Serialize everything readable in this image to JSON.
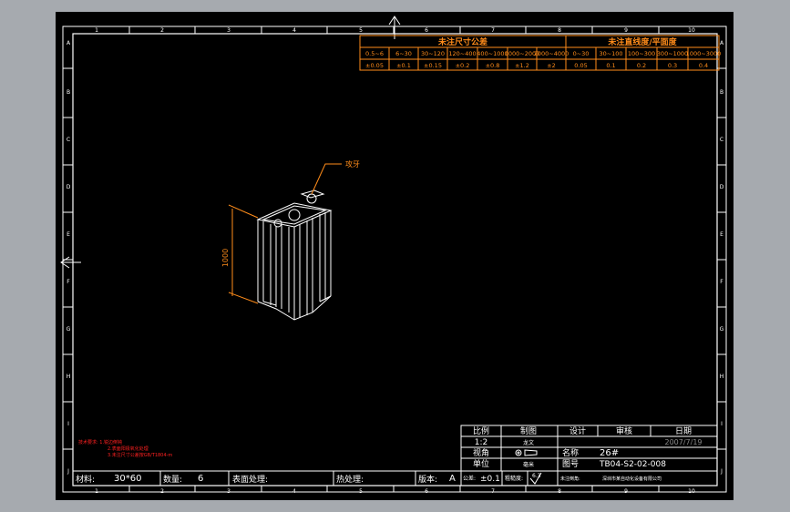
{
  "grid": {
    "cols": [
      "1",
      "2",
      "3",
      "4",
      "5",
      "6",
      "7",
      "8",
      "9",
      "10"
    ],
    "rows": [
      "A",
      "B",
      "C",
      "D",
      "E",
      "F",
      "G",
      "H",
      "I",
      "J"
    ]
  },
  "tolerance": {
    "linear_title": "未注尺寸公差",
    "angular_title": "未注直线度/平面度",
    "linear_ranges": [
      "0.5~6",
      "6~30",
      "30~120",
      "120~400",
      "400~1000",
      "1000~2000",
      "2000~4000"
    ],
    "linear_values": [
      "±0.05",
      "±0.1",
      "±0.15",
      "±0.2",
      "±0.8",
      "±1.2",
      "±2"
    ],
    "angular_ranges": [
      "0~30",
      "30~100",
      "100~300",
      "300~1000",
      "1000~3000"
    ],
    "angular_values": [
      "0.05",
      "0.1",
      "0.2",
      "0.3",
      "0.4"
    ]
  },
  "drawing": {
    "callout": "攻牙",
    "dimension": "1000"
  },
  "notes": {
    "line1": "技术要求: 1.锐边倒钝",
    "line2": "2.表面阳极氧化处理",
    "line3": "3.未注尺寸公差按GB/T1804-m"
  },
  "title_block": {
    "scale_label": "比例",
    "scale_value": "1:2",
    "draw_label": "制图",
    "draw_sub": "龙文",
    "design_label": "设计",
    "review_label": "审核",
    "date_label": "日期",
    "date_value": "2007/7/19",
    "angle_label": "视角",
    "name_label": "名称",
    "name_value": "26#",
    "unit_label": "单位",
    "unit_value": "毫米",
    "drawing_no_label": "图号",
    "drawing_no_value": "TB04-S2-02-008",
    "material_label": "材料:",
    "material_value": "30*60",
    "qty_label": "数量:",
    "qty_value": "6",
    "surface_label": "表面处理:",
    "heat_label": "热处理:",
    "version_label": "版本:",
    "version_value": "A",
    "tol_label": "公差:",
    "tol_value": "±0.1",
    "rough_label": "粗糙度:",
    "rough_value": "6.3",
    "untol_label": "未注倒角:",
    "company": "深圳市某自动化设备有限公司"
  }
}
